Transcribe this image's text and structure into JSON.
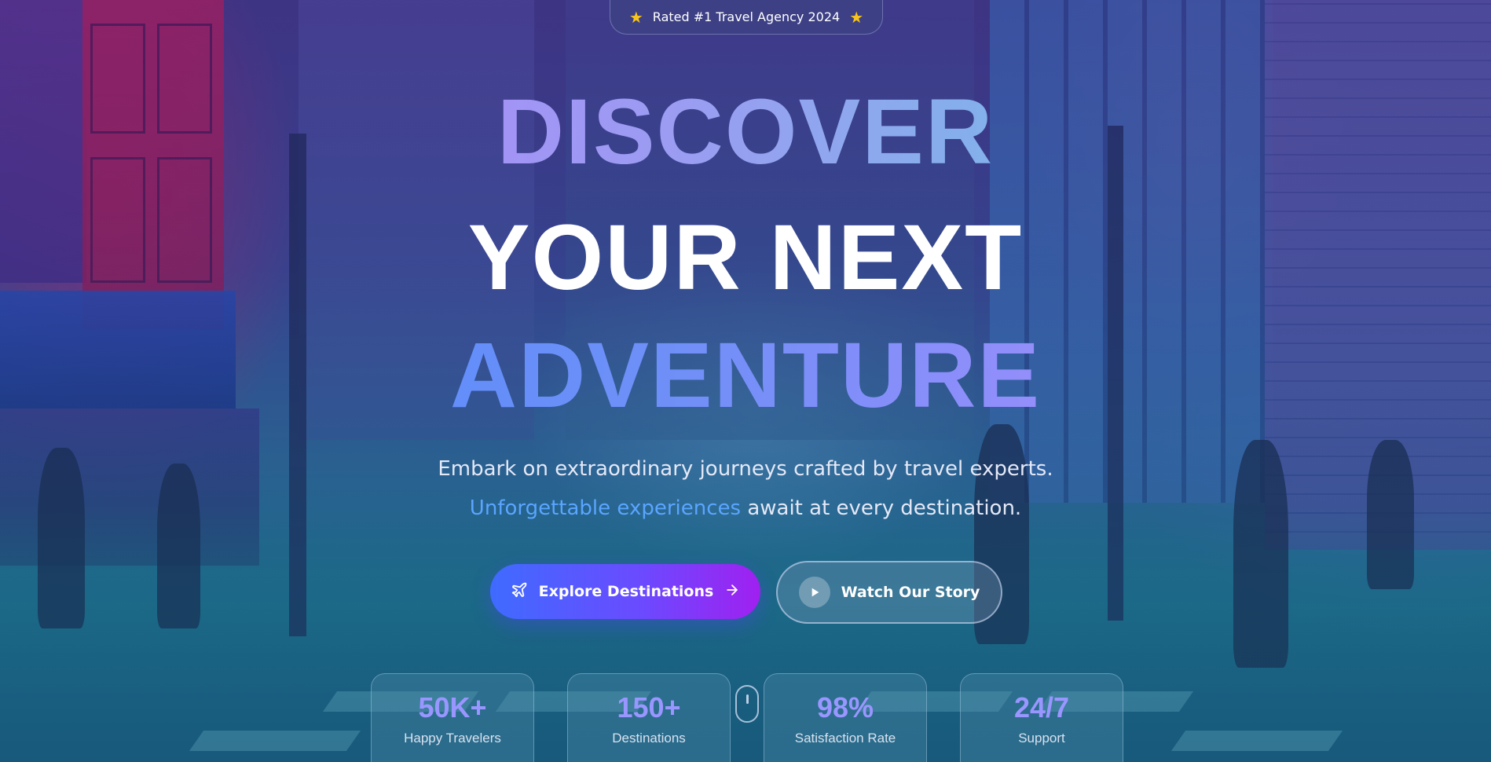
{
  "badge": {
    "text": "Rated #1 Travel Agency 2024",
    "icon_left": "star-icon",
    "icon_right": "star-icon",
    "icon_color": "#f9c51a"
  },
  "hero": {
    "line1": "DISCOVER",
    "line2": "YOUR NEXT",
    "line3": "ADVENTURE",
    "subtitle_line1": "Embark on extraordinary journeys crafted by travel experts.",
    "subtitle_highlight": "Unforgettable experiences",
    "subtitle_line2_rest": " await at every destination."
  },
  "buttons": {
    "primary_label": "Explore Destinations",
    "primary_icon_left": "plane-icon",
    "primary_icon_right": "arrow-right-icon",
    "secondary_label": "Watch Our Story",
    "secondary_icon": "play-icon"
  },
  "stats": [
    {
      "value": "50K+",
      "label": "Happy Travelers"
    },
    {
      "value": "150+",
      "label": "Destinations"
    },
    {
      "value": "98%",
      "label": "Satisfaction Rate"
    },
    {
      "value": "24/7",
      "label": "Support"
    }
  ],
  "colors": {
    "accent_blue": "#5aa5ff",
    "stat_value": "#9a96ff",
    "primary_gradient_start": "#3f6bff",
    "primary_gradient_end": "#a020f0"
  },
  "scroll_indicator_icon": "mouse-scroll-icon"
}
